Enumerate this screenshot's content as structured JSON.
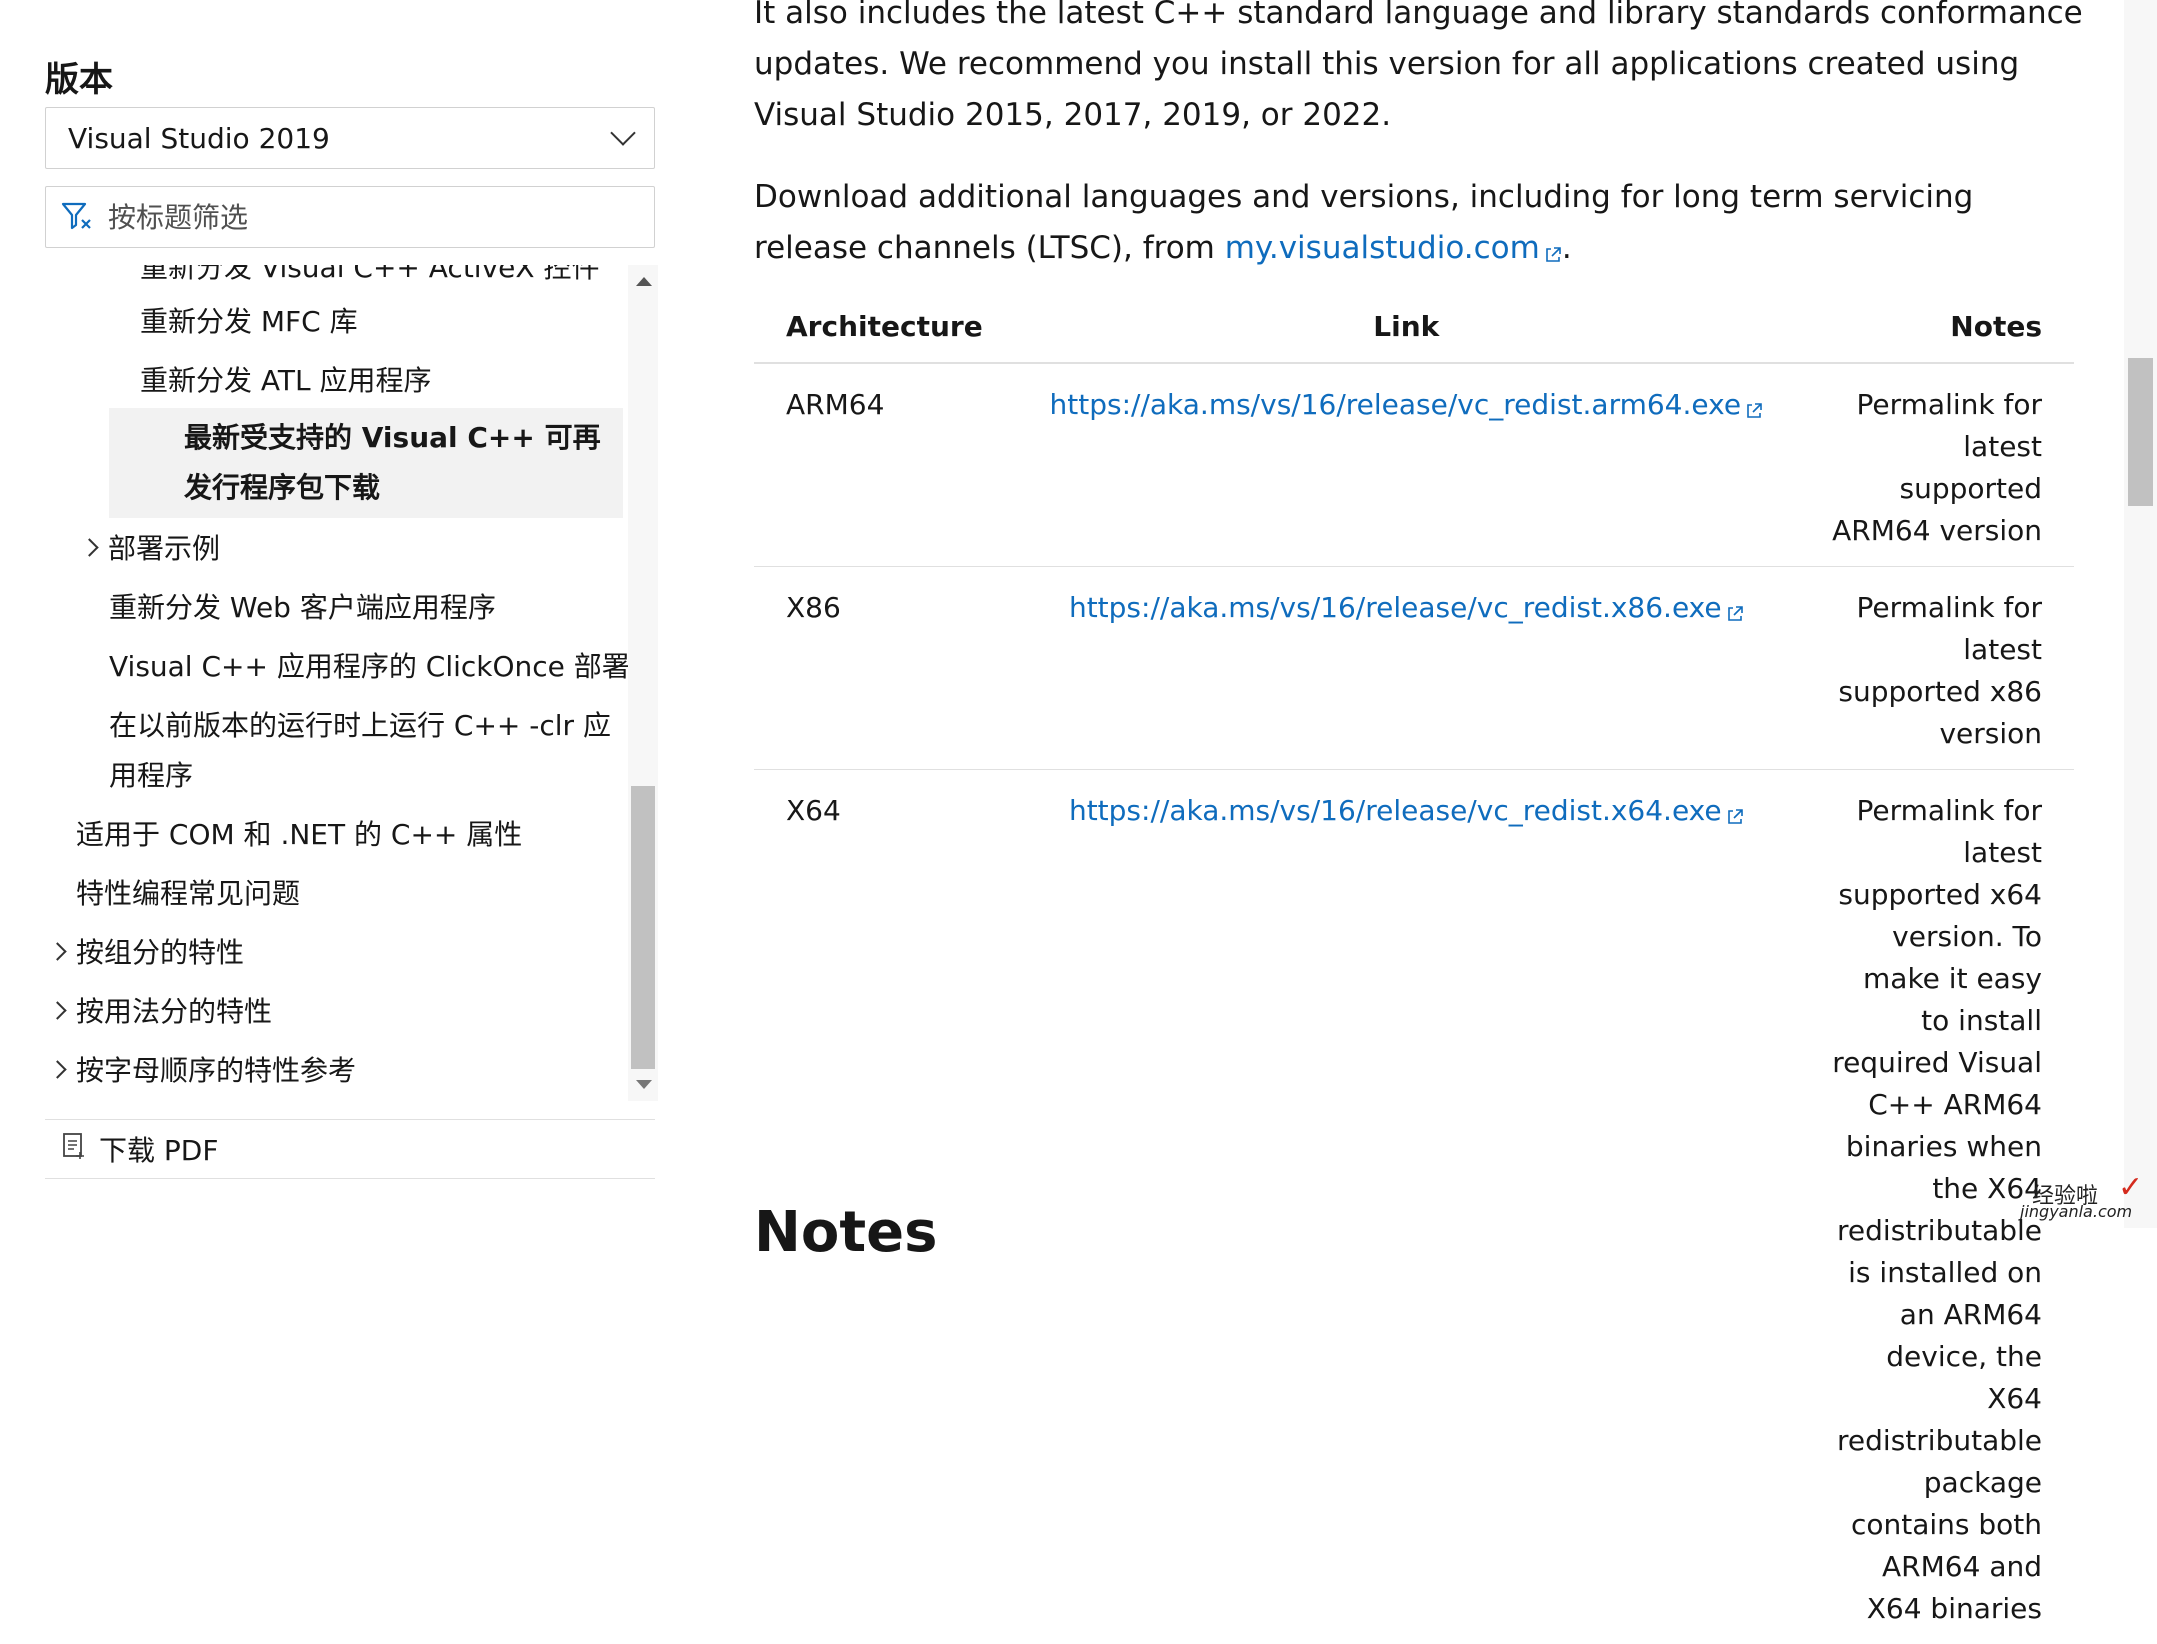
{
  "sidebar": {
    "version_heading": "版本",
    "version_select": {
      "value": "Visual Studio 2019"
    },
    "filter": {
      "placeholder": "按标题筛选"
    },
    "toc": [
      "重新分发 Visual C++ ActiveX 控件",
      "重新分发 MFC 库",
      "重新分发 ATL 应用程序",
      "最新受支持的 Visual C++ 可再发行程序包下载",
      "部署示例",
      "重新分发 Web 客户端应用程序",
      "Visual C++ 应用程序的 ClickOnce 部署",
      "在以前版本的运行时上运行 C++ -clr 应用程序",
      "适用于 COM 和 .NET 的 C++ 属性",
      "特性编程常见问题",
      "按组分的特性",
      "按用法分的特性",
      "按字母顺序的特性参考"
    ],
    "download_pdf": "下载 PDF"
  },
  "main": {
    "para1": "It also includes the latest C++ standard language and library standards conformance updates. We recommend you install this version for all applications created using Visual Studio 2015, 2017, 2019, or 2022.",
    "para2_text": "Download additional languages and versions, including for long term servicing release channels (LTSC), from ",
    "para2_link": "my.visualstudio.com",
    "para2_end": ".",
    "table": {
      "headers": {
        "architecture": "Architecture",
        "link": "Link",
        "notes": "Notes"
      },
      "rows": [
        {
          "arch": "ARM64",
          "link": "https://aka.ms/vs/16/release/vc_redist.arm64.exe",
          "notes": "Permalink for latest supported ARM64 version"
        },
        {
          "arch": "X86",
          "link": "https://aka.ms/vs/16/release/vc_redist.x86.exe",
          "notes": "Permalink for latest supported x86 version"
        },
        {
          "arch": "X64",
          "link": "https://aka.ms/vs/16/release/vc_redist.x64.exe",
          "notes": "Permalink for latest supported x64 version. To make it easy to install required Visual C++ ARM64 binaries when the X64 redistributable is installed on an ARM64 device, the X64 redistributable package contains both ARM64 and X64 binaries"
        }
      ]
    },
    "next_heading": "Notes"
  },
  "watermark": {
    "top": "经验啦",
    "check": "✓",
    "bottom": "jingyanla.com"
  },
  "colors": {
    "link": "#0f6cbd",
    "active_bg": "#f2f2f2",
    "border": "#e0e0e0"
  }
}
